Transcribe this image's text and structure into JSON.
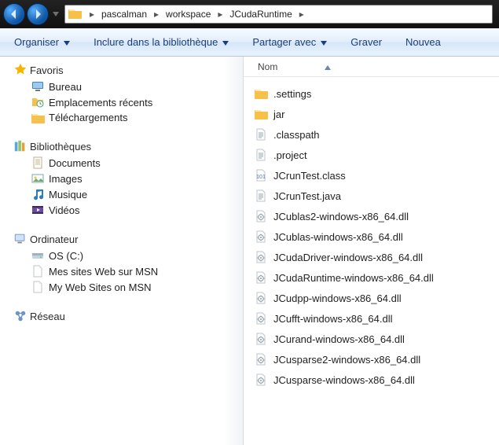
{
  "breadcrumb": {
    "segments": [
      "pascalman",
      "workspace",
      "JCudaRuntime"
    ]
  },
  "toolbar": {
    "organize": "Organiser",
    "include": "Inclure dans la bibliothèque",
    "share": "Partager avec",
    "burn": "Graver",
    "new": "Nouvea"
  },
  "nav": {
    "favorites": {
      "label": "Favoris",
      "items": [
        {
          "label": "Bureau",
          "icon": "desktop"
        },
        {
          "label": "Emplacements récents",
          "icon": "recent"
        },
        {
          "label": "Téléchargements",
          "icon": "folder"
        }
      ]
    },
    "libraries": {
      "label": "Bibliothèques",
      "items": [
        {
          "label": "Documents",
          "icon": "documents"
        },
        {
          "label": "Images",
          "icon": "images"
        },
        {
          "label": "Musique",
          "icon": "music"
        },
        {
          "label": "Vidéos",
          "icon": "videos"
        }
      ]
    },
    "computer": {
      "label": "Ordinateur",
      "items": [
        {
          "label": "OS (C:)",
          "icon": "drive"
        },
        {
          "label": "Mes sites Web sur MSN",
          "icon": "page"
        },
        {
          "label": "My Web Sites on MSN",
          "icon": "page"
        }
      ]
    },
    "network": {
      "label": "Réseau"
    }
  },
  "columns": {
    "name": "Nom"
  },
  "files": [
    {
      "name": ".settings",
      "icon": "folder"
    },
    {
      "name": "jar",
      "icon": "folder"
    },
    {
      "name": ".classpath",
      "icon": "txt"
    },
    {
      "name": ".project",
      "icon": "txt"
    },
    {
      "name": "JCrunTest.class",
      "icon": "class"
    },
    {
      "name": "JCrunTest.java",
      "icon": "txt"
    },
    {
      "name": "JCublas2-windows-x86_64.dll",
      "icon": "dll"
    },
    {
      "name": "JCublas-windows-x86_64.dll",
      "icon": "dll"
    },
    {
      "name": "JCudaDriver-windows-x86_64.dll",
      "icon": "dll"
    },
    {
      "name": "JCudaRuntime-windows-x86_64.dll",
      "icon": "dll"
    },
    {
      "name": "JCudpp-windows-x86_64.dll",
      "icon": "dll"
    },
    {
      "name": "JCufft-windows-x86_64.dll",
      "icon": "dll"
    },
    {
      "name": "JCurand-windows-x86_64.dll",
      "icon": "dll"
    },
    {
      "name": "JCusparse2-windows-x86_64.dll",
      "icon": "dll"
    },
    {
      "name": "JCusparse-windows-x86_64.dll",
      "icon": "dll"
    }
  ]
}
